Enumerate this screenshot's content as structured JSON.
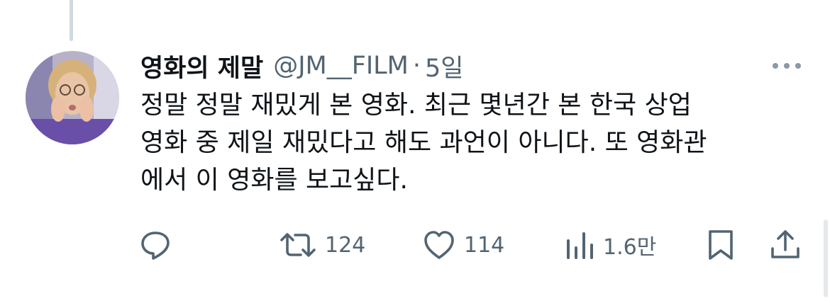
{
  "tweet": {
    "author": {
      "display_name": "영화의 제말",
      "handle": "@JM__FILM"
    },
    "separator": "·",
    "time": "5일",
    "text_lines": [
      "정말 정말 재밌게 본 영화. 최근 몇년간 본 한국 상업",
      "영화 중 제일 재밌다고 해도 과언이 아니다. 또 영화관",
      "에서 이 영화를 보고싶다."
    ],
    "actions": {
      "reply_icon": "reply-icon",
      "retweet_icon": "retweet-icon",
      "retweet_count": "124",
      "like_icon": "heart-icon",
      "like_count": "114",
      "views_icon": "views-icon",
      "views_count": "1.6만",
      "bookmark_icon": "bookmark-icon",
      "share_icon": "share-icon"
    },
    "more_icon": "more-icon"
  },
  "colors": {
    "text": "#0f1419",
    "secondary": "#536471",
    "thread_line": "#cfd9de"
  }
}
